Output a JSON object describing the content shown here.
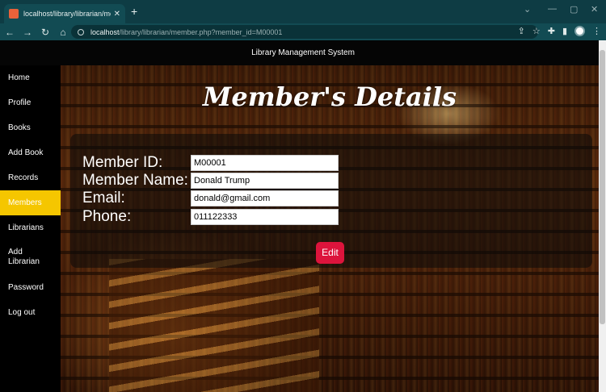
{
  "browser": {
    "tab_title": "localhost/library/librarian/memb",
    "tab_close": "✕",
    "new_tab": "+",
    "url_host": "localhost",
    "url_path": "/library/librarian/member.php?member_id=M00001"
  },
  "header": {
    "title": "Library Management System"
  },
  "sidebar": {
    "items": [
      {
        "label": "Home",
        "active": false
      },
      {
        "label": "Profile",
        "active": false
      },
      {
        "label": "Books",
        "active": false
      },
      {
        "label": "Add Book",
        "active": false
      },
      {
        "label": "Records",
        "active": false
      },
      {
        "label": "Members",
        "active": true
      },
      {
        "label": "Librarians",
        "active": false
      },
      {
        "label": "Add Librarian",
        "active": false
      },
      {
        "label": "Password",
        "active": false
      },
      {
        "label": "Log out",
        "active": false
      }
    ]
  },
  "main": {
    "title": "Member's Details",
    "fields": [
      {
        "label": "Member ID:",
        "value": "M00001"
      },
      {
        "label": "Member Name:",
        "value": "Donald Trump"
      },
      {
        "label": "Email:",
        "value": "donald@gmail.com"
      },
      {
        "label": "Phone:",
        "value": "011122333"
      }
    ],
    "edit_label": "Edit"
  },
  "colors": {
    "active_nav": "#f5c600",
    "edit_button": "#dc143c",
    "browser_chrome": "#0e3c44"
  }
}
